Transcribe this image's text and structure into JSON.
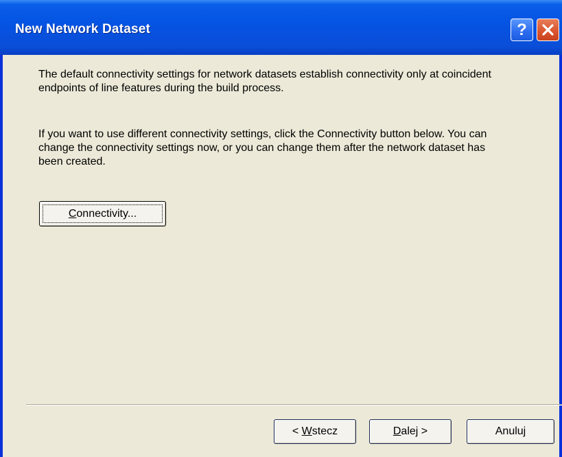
{
  "window": {
    "title": "New Network Dataset",
    "help_label": "?",
    "close_icon": "close-x-icon"
  },
  "content": {
    "paragraph1": "The default connectivity settings for network datasets establish connectivity only at coincident endpoints of line features during the build process.",
    "paragraph2": "If you want to use different connectivity settings, click the Connectivity button below.  You can change the connectivity settings now, or you can change them after the network dataset has been created.",
    "connectivity_button": {
      "mnemonic": "C",
      "rest": "onnectivity..."
    }
  },
  "footer": {
    "back_button": {
      "prefix": "< ",
      "mnemonic": "W",
      "rest": "stecz"
    },
    "next_button": {
      "mnemonic": "D",
      "rest": "alej >"
    },
    "cancel_button": "Anuluj"
  }
}
